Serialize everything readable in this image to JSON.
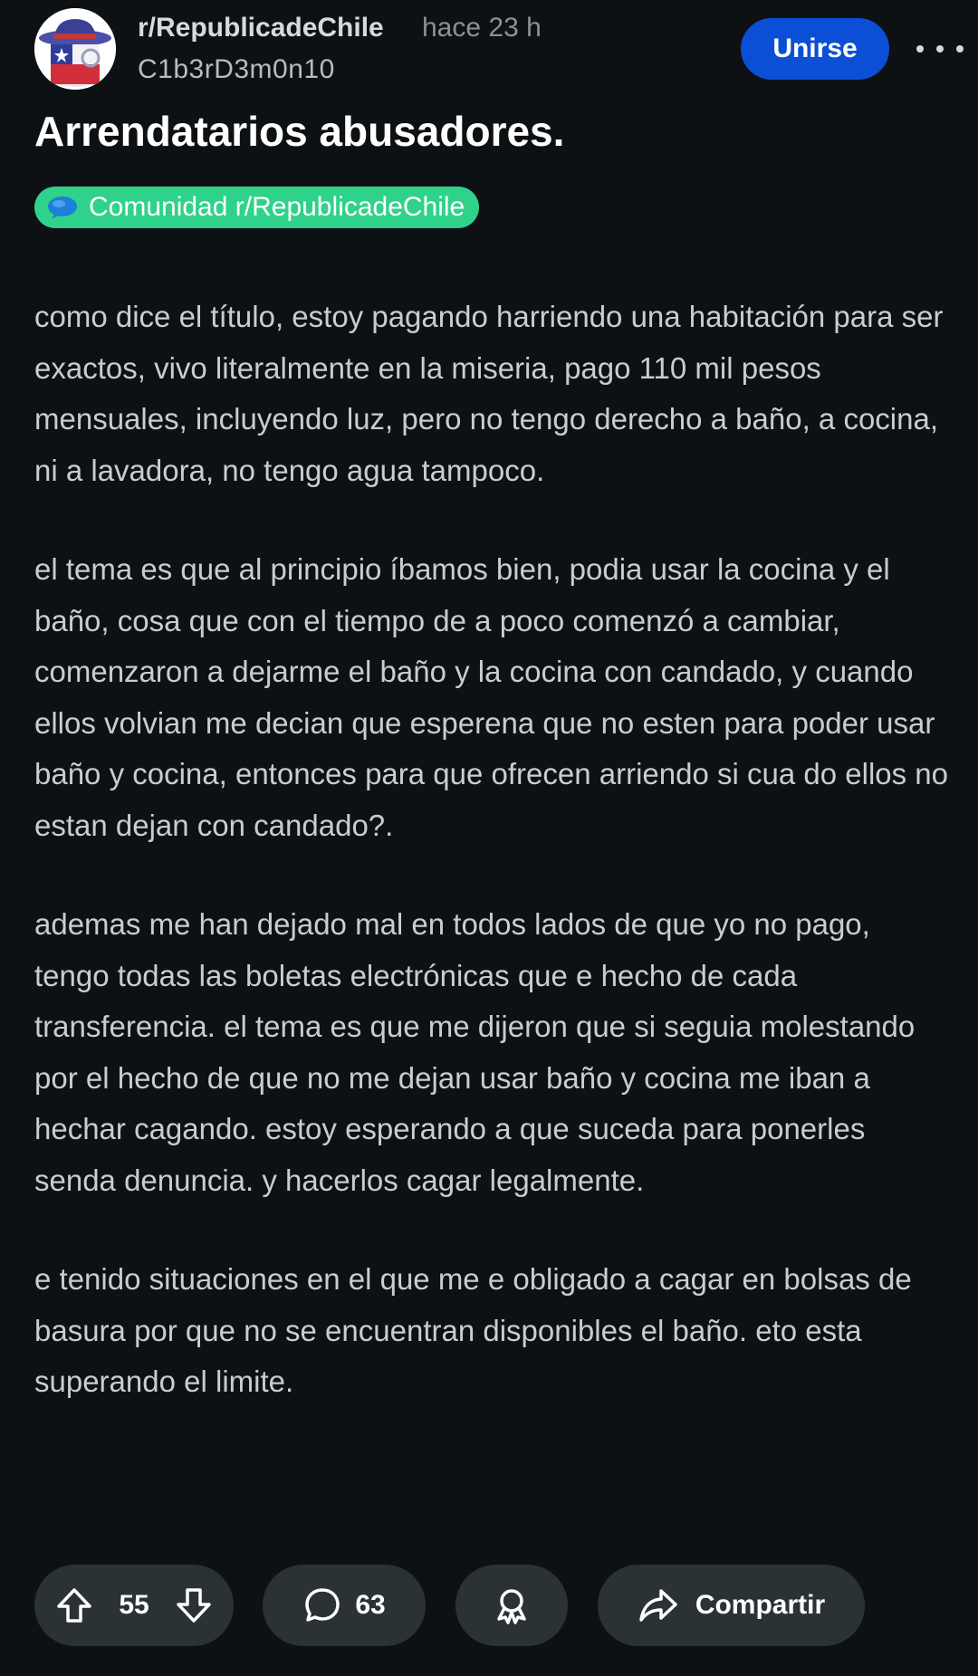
{
  "header": {
    "subreddit": "r/RepublicadeChile",
    "time": "hace 23 h",
    "author": "C1b3rD3m0n10",
    "join_label": "Unirse",
    "avatar_icon": "chile-hat-avatar-icon",
    "more_icon": "more-dots-icon"
  },
  "post": {
    "title": "Arrendatarios abusadores.",
    "flair": "Comunidad r/RepublicadeChile",
    "flair_color": "#2fd28a",
    "paragraphs": [
      "como dice el título, estoy pagando harriendo una habitación para ser exactos, vivo literalmente en la miseria, pago 110 mil pesos mensuales, incluyendo luz, pero no tengo derecho a baño, a cocina, ni a lavadora, no tengo agua tampoco.",
      "el tema es que al principio íbamos bien, podia usar la cocina y el baño, cosa que con el tiempo de a poco comenzó a cambiar, comenzaron a dejarme el baño y la cocina con candado, y cuando ellos volvian me decian que esperena que no esten para poder usar baño y cocina, entonces para que ofrecen arriendo si cua do ellos no estan dejan con candado?.",
      "ademas me han dejado mal en todos lados de que yo no pago, tengo todas las boletas electrónicas que e hecho de cada transferencia. el tema es que me dijeron que si seguia molestando por el hecho de que no me dejan usar baño y cocina me iban a hechar cagando. estoy esperando a que suceda para ponerles senda denuncia. y hacerlos cagar legalmente.",
      "e tenido situaciones en el que me e obligado a cagar en bolsas de basura por que no se encuentran disponibles el baño. eto esta superando el limite."
    ]
  },
  "actions": {
    "votes": "55",
    "comments": "63",
    "share_label": "Compartir",
    "icons": [
      "upvote-icon",
      "downvote-icon",
      "comment-icon",
      "award-icon",
      "share-icon"
    ]
  },
  "colors": {
    "background": "#0e1113",
    "join_button": "#0a4fd6",
    "pill_background": "#2a3236"
  }
}
